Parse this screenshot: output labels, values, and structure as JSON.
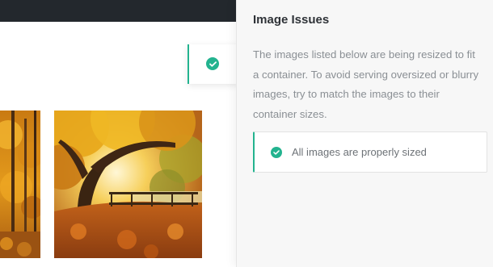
{
  "panel": {
    "title": "Image Issues",
    "description": "The images listed below are being resized to fit a container. To avoid serving oversized or blurry images, try to match the images to their container sizes.",
    "notice": {
      "text": "All images are properly sized",
      "status": "success",
      "icon": "check-circle-icon"
    }
  },
  "floating_tab": {
    "icon": "check-circle-icon",
    "status": "success"
  },
  "canvas": {
    "images": [
      {
        "subject": "autumn forest"
      },
      {
        "subject": "autumn tree with footbridge"
      }
    ]
  },
  "colors": {
    "accent": "#23b38f",
    "topbar": "#23282d",
    "panel_bg": "#f7f7f7",
    "title": "#2f3338",
    "body_text": "#8a8f94"
  }
}
